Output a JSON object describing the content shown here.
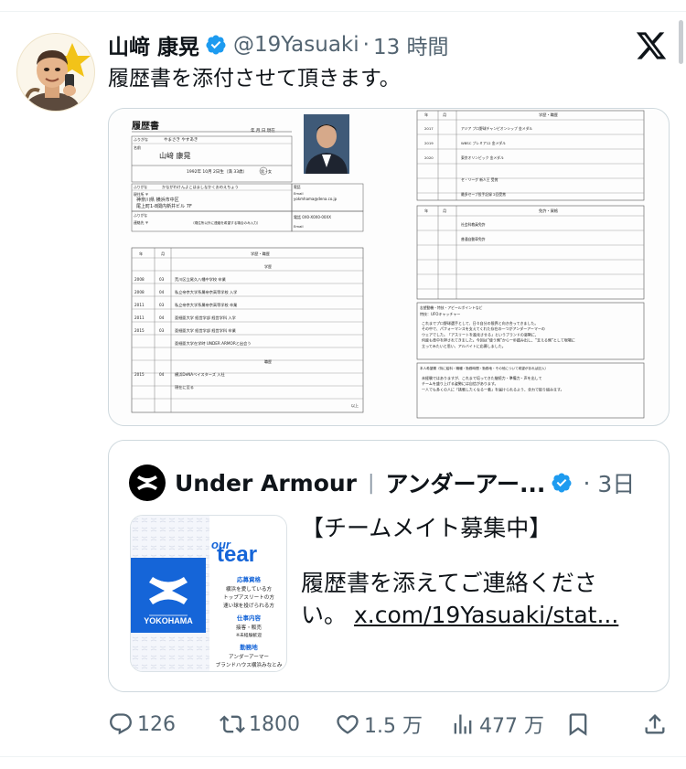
{
  "post": {
    "author_name": "山﨑 康晃",
    "handle": "@19Yasuaki",
    "separator": "·",
    "time": "13 時間",
    "text": "履歴書を添付させて頂きます。",
    "verified": true
  },
  "resume_image": {
    "title": "履歴書",
    "date_fields": "年  月  日 現在",
    "furigana_label": "ふりがな",
    "furigana_value": "やまさき  やすあき",
    "name_label": "名前",
    "name_value": "山﨑  康晃",
    "birth": "1992年  10月  2日生（満 33歳）",
    "gender": "男・女",
    "address_furigana": "かながわけんよこはましなかくおのえちょう",
    "address_label": "現住所  〒",
    "address_line1": "神奈川県 横浜市中区",
    "address_line2": "尾上町1-8関内新井ビル 7F",
    "tel_label": "電話",
    "email_label": "Email",
    "email_value": "yokmhama@dena.co.jp",
    "contact_label": "連絡先  〒",
    "contact_note": "（現住所以外に連絡を希望する場合のみ入力）",
    "contact_tel": "電話  0X0-X0X0-00XX",
    "contact_email": "Email",
    "col_year": "年",
    "col_month": "月",
    "col_history": "学歴・職歴",
    "edu_heading": "学歴",
    "history_rows": [
      {
        "year": "2008",
        "month": "03",
        "text": "荒川区立尾久八幡中学校 卒業"
      },
      {
        "year": "2008",
        "month": "04",
        "text": "私立帝京大学系属帝京高等学校 入学"
      },
      {
        "year": "2011",
        "month": "03",
        "text": "私立帝京大学系属帝京高等学校 卒業"
      },
      {
        "year": "2011",
        "month": "04",
        "text": "亜細亜大学 経営学部 経営学科 入学"
      },
      {
        "year": "2015",
        "month": "03",
        "text": "亜細亜大学 経営学部 経営学科 卒業"
      },
      {
        "year": "",
        "month": "",
        "text": "亜細亜大学在学時 UNDER ARMORと出会う"
      }
    ],
    "work_heading": "職歴",
    "work_rows": [
      {
        "year": "2015",
        "month": "04",
        "text": "横浜DeNAベイスターズ 入社"
      },
      {
        "year": "",
        "month": "",
        "text": "現在に至る"
      }
    ],
    "end_mark": "以上",
    "r_col_history": "学歴・職歴",
    "right_rows": [
      {
        "year": "2017",
        "text": "アジア プロ野球チャンピオンシップ 金メダル"
      },
      {
        "year": "2019",
        "text": "WBSC プレミア12 金メダル"
      },
      {
        "year": "2020",
        "text": "東京オリンピック 金メダル"
      },
      {
        "year": "",
        "text": "セ・リーグ 新人王 受賞"
      },
      {
        "year": "",
        "text": "最多セーブ投手記録 2回受賞"
      }
    ],
    "r_col_license": "免許・資格",
    "license_rows": [
      "社会科教員免許",
      "普通自動車免許"
    ],
    "motivation_label": "志望動機・特技・アピールポイントなど",
    "motivation_sub": "特技：UFOキャッチャー",
    "motivation_lines": [
      "これまでプロ野球選手として、日々自分の限界と向き合ってきました。",
      "その中で、パフォーマンスを支えてくれた存在の一つがアンダーアーマーの",
      "ウェアでした。「アスリートを進化させる」というブランドの姿勢に、",
      "何度も背中を押されてきました。今回は“使う側”から一歩踏み出し、“支える側”として現場に",
      "立ってみたいと思い、アルバイトに応募しました。"
    ],
    "wish_label": "本人希望欄（特に給料・職種・勤務時間・勤務地・その他について希望があれば記入）",
    "wish_lines": [
      "未経験ではありますが、これまで培ってきた継続力・準備力・声を出して",
      "チームを盛り上げる姿勢には自信があります。",
      "一人でも多くの人に「挑戦したくなる一着」を届けられるよう、全力で取り組みます。"
    ]
  },
  "quote": {
    "name": "Under Armour",
    "separator": "|",
    "name2": "アンダーアー...",
    "dot": "·",
    "time": "3日",
    "line1": "【チームメイト募集中】",
    "line2": "履歴書を添えてご連絡ください。",
    "link": "x.com/19Yasuaki/stat...",
    "thumb": {
      "badge_label": "YOKOHAMA",
      "brand_small": "our",
      "brand_large": "tear",
      "section1_title": "応募資格",
      "section1_lines": [
        "横浜を愛している方",
        "トップアスリートの方",
        "速い球を投げられる方"
      ],
      "section2_title": "仕事内容",
      "section2_lines": [
        "接客・販売",
        "※未経験歓迎"
      ],
      "section3_title": "勤務地",
      "section3_lines": [
        "アンダーアーマー",
        "ブランドハウス横浜みなとみ"
      ]
    }
  },
  "actions": {
    "reply": "126",
    "retweet": "1800",
    "like": "1.5 万",
    "views": "477 万"
  },
  "colors": {
    "text": "#0f1419",
    "muted": "#536471",
    "border": "#cfd9de",
    "verified": "#1d9bf0",
    "ua_blue": "#1565d8"
  },
  "icons": {
    "verified": "verified-badge-icon",
    "x_logo": "x-logo-icon",
    "reply": "reply-icon",
    "retweet": "retweet-icon",
    "like": "heart-icon",
    "views": "views-icon",
    "bookmark": "bookmark-icon",
    "share": "share-icon"
  }
}
